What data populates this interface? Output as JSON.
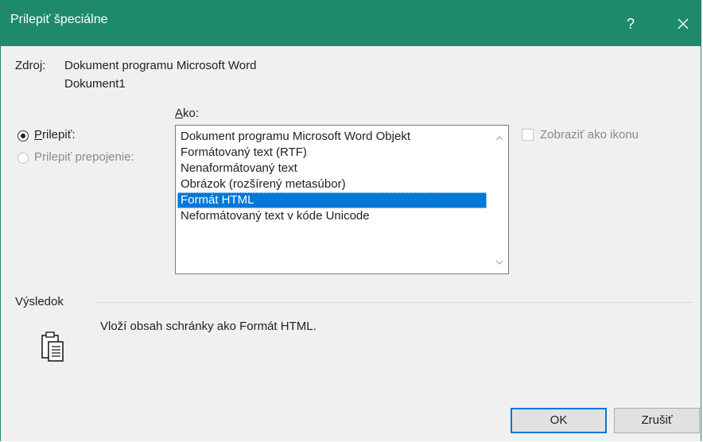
{
  "window": {
    "title": "Prilepiť špeciálne",
    "help_label": "?",
    "titlebar_color": "#1e8a6c"
  },
  "source": {
    "label": "Zdroj:",
    "value_line1": "Dokument programu Microsoft Word",
    "value_line2": "Dokument1"
  },
  "as": {
    "label_hotkey": "A",
    "label_rest": "ko:"
  },
  "options": {
    "paste_hotkey": "P",
    "paste_rest": "rilepiť:",
    "paste_checked": true,
    "paste_link_label": "Prilepiť prepojenie:",
    "paste_link_enabled": false
  },
  "list": {
    "items": [
      "Dokument programu Microsoft Word Objekt",
      "Formátovaný text (RTF)",
      "Nenaformátovaný text",
      "Obrázok (rozšírený metasúbor)",
      "Formát HTML",
      "Neformátovaný text v kóde Unicode"
    ],
    "selected_index": 4,
    "selection_color": "#0078d7"
  },
  "display_as_icon": {
    "label": "Zobraziť ako ikonu",
    "checked": false,
    "enabled": false
  },
  "result": {
    "label": "Výsledok",
    "text": "Vloží obsah schránky ako Formát HTML.",
    "icon": "clipboard-icon"
  },
  "buttons": {
    "ok": "OK",
    "cancel": "Zrušiť"
  }
}
